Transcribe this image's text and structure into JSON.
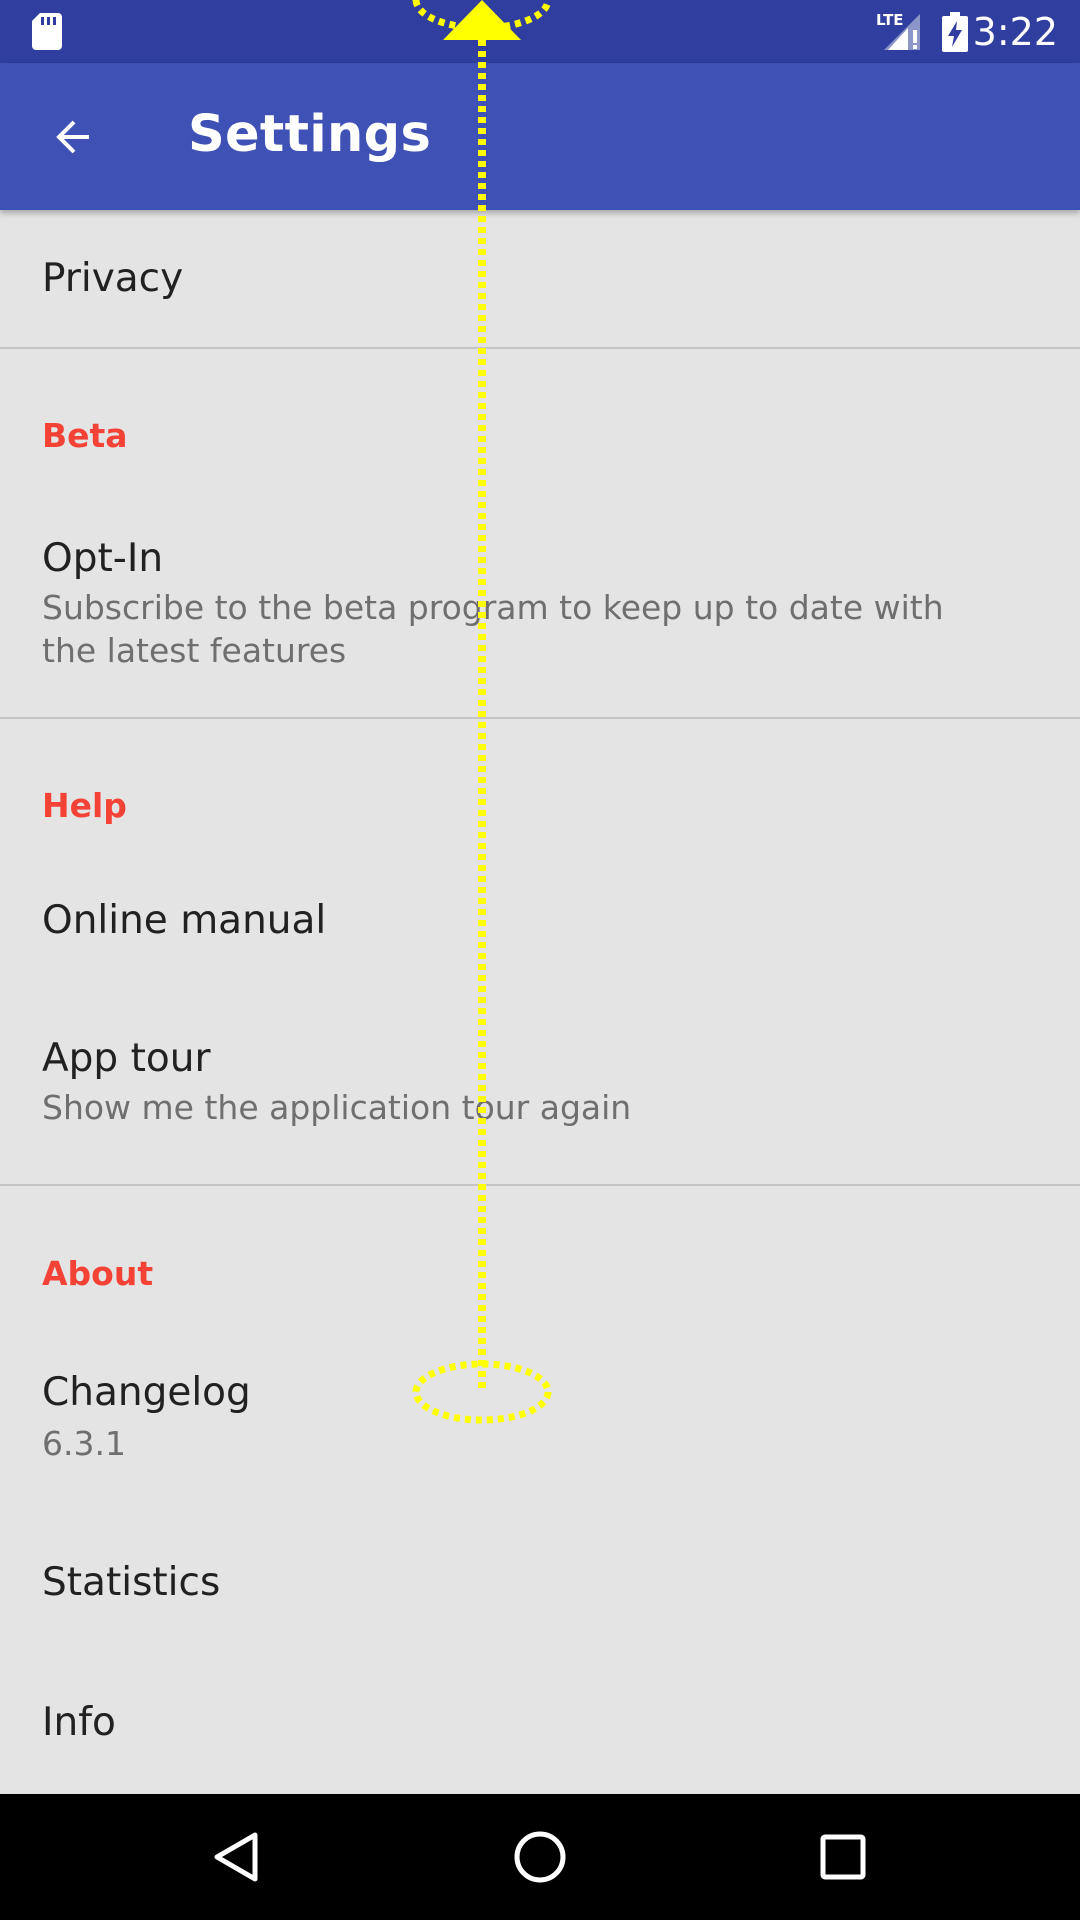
{
  "status_bar": {
    "time": "3:22",
    "network_label": "LTE",
    "icons": [
      "sd-card-icon",
      "lte-signal-icon",
      "battery-charging-icon"
    ]
  },
  "app_bar": {
    "title": "Settings",
    "back_icon": "arrow-back-icon"
  },
  "settings": {
    "privacy": {
      "title": "Privacy"
    },
    "beta": {
      "header": "Beta",
      "opt_in": {
        "title": "Opt-In",
        "summary": "Subscribe to the beta program to keep up to date with the latest features"
      }
    },
    "help": {
      "header": "Help",
      "online_manual": {
        "title": "Online manual"
      },
      "app_tour": {
        "title": "App tour",
        "summary": "Show me the application tour again"
      }
    },
    "about": {
      "header": "About",
      "changelog": {
        "title": "Changelog",
        "summary": "6.3.1"
      },
      "statistics": {
        "title": "Statistics"
      },
      "info": {
        "title": "Info"
      }
    }
  },
  "gesture": {
    "type": "swipe-up",
    "color": "#ffff00"
  },
  "nav_bar": {
    "icons": [
      "back-triangle-icon",
      "home-circle-icon",
      "recents-square-icon"
    ]
  },
  "colors": {
    "status_bar": "#303f9f",
    "app_bar": "#3f51b5",
    "category_accent": "#f44336",
    "background": "#e4e4e4"
  }
}
